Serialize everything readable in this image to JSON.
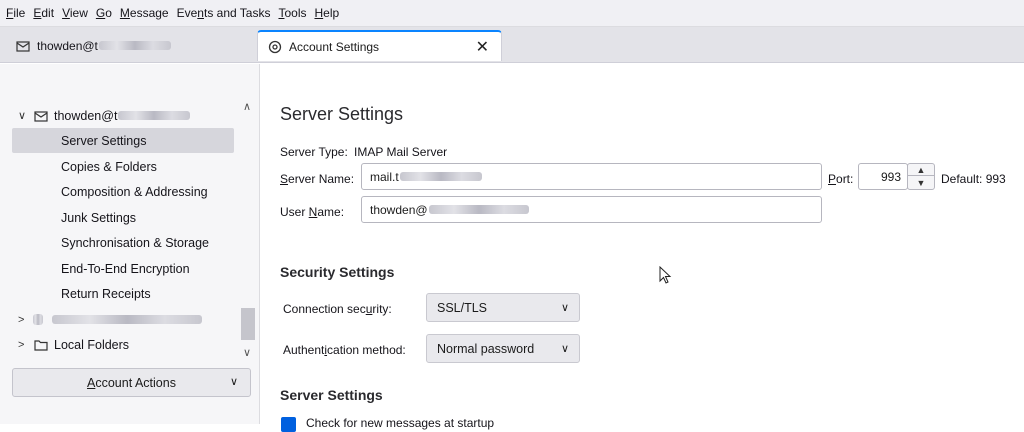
{
  "menubar": {
    "items": [
      {
        "pre": "",
        "acc": "F",
        "post": "ile"
      },
      {
        "pre": "",
        "acc": "E",
        "post": "dit"
      },
      {
        "pre": "",
        "acc": "V",
        "post": "iew"
      },
      {
        "pre": "",
        "acc": "G",
        "post": "o"
      },
      {
        "pre": "",
        "acc": "M",
        "post": "essage"
      },
      {
        "pre": "Eve",
        "acc": "n",
        "post": "ts and Tasks"
      },
      {
        "pre": "",
        "acc": "T",
        "post": "ools"
      },
      {
        "pre": "",
        "acc": "H",
        "post": "elp"
      }
    ]
  },
  "tabs": {
    "mail_tab": "thowden@t",
    "settings_tab": "Account Settings",
    "close_symbol": "✕"
  },
  "sidebar": {
    "account": "thowden@t",
    "items": [
      "Server Settings",
      "Copies & Folders",
      "Composition & Addressing",
      "Junk Settings",
      "Synchronisation & Storage",
      "End-To-End Encryption",
      "Return Receipts"
    ],
    "local_folders": "Local Folders",
    "account_actions": {
      "acc": "A",
      "rest": "ccount Actions"
    }
  },
  "main": {
    "title": "Server Settings",
    "server_type_label": "Server Type:",
    "server_type_value": "IMAP Mail Server",
    "server_name_label": {
      "acc": "S",
      "rest": "erver Name:"
    },
    "server_name_value": "mail.t",
    "port_label": {
      "acc": "P",
      "rest": "ort:"
    },
    "port_value": "993",
    "default_label": "Default: 993",
    "user_name_label": {
      "pre": "User ",
      "acc": "N",
      "post": "ame:"
    },
    "user_name_value": "thowden@",
    "security_heading": "Security Settings",
    "connection_security_label": {
      "pre": "Connection sec",
      "acc": "u",
      "post": "rity:"
    },
    "connection_security_value": "SSL/TLS",
    "auth_method_label": {
      "pre": "Authent",
      "acc": "i",
      "post": "cation method:"
    },
    "auth_method_value": "Normal password",
    "server_settings_heading": "Server Settings",
    "check_new_messages_label": "Check for new messages at startup"
  },
  "colors": {
    "accent": "#0060df",
    "tab_indicator": "#0a84ff",
    "selected_row": "#d6d6dc"
  }
}
